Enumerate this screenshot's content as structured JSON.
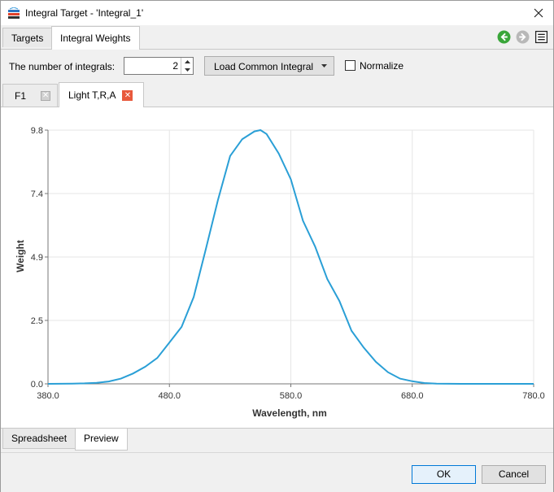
{
  "window": {
    "title": "Integral Target - 'Integral_1'"
  },
  "top_tabs": [
    {
      "label": "Targets",
      "active": false
    },
    {
      "label": "Integral Weights",
      "active": true
    }
  ],
  "toolbar": {
    "num_integrals_label": "The number of integrals:",
    "num_integrals_value": "2",
    "load_common_label": "Load Common Integral",
    "normalize_label": "Normalize",
    "normalize_checked": false
  },
  "integral_tabs": [
    {
      "label": "F1",
      "active": false
    },
    {
      "label": "Light T,R,A",
      "active": true
    }
  ],
  "bottom_tabs": [
    {
      "label": "Spreadsheet",
      "active": false
    },
    {
      "label": "Preview",
      "active": true
    }
  ],
  "footer": {
    "ok_label": "OK",
    "cancel_label": "Cancel"
  },
  "icons": {
    "app": "app-icon",
    "close": "close-icon",
    "back": "back-arrow-icon",
    "forward": "forward-arrow-icon",
    "notes": "notes-icon"
  },
  "colors": {
    "line": "#2a9fd6",
    "grid": "#e6e6e6",
    "close_tab_active": "#e8593c"
  },
  "chart_data": {
    "type": "line",
    "xlabel": "Wavelength, nm",
    "ylabel": "Weight",
    "xlim": [
      380,
      780
    ],
    "ylim": [
      0,
      9.8
    ],
    "x_ticks": [
      380.0,
      480.0,
      580.0,
      680.0,
      780.0
    ],
    "x_tick_labels": [
      "380.0",
      "480.0",
      "580.0",
      "680.0",
      "780.0"
    ],
    "y_ticks": [
      0,
      2.45,
      4.9,
      7.35,
      9.8
    ],
    "y_tick_labels": [
      "0.0",
      "2.5",
      "4.9",
      "7.4",
      "9.8"
    ],
    "grid": true,
    "series": [
      {
        "x": [
          380,
          400,
          410,
          420,
          430,
          440,
          450,
          460,
          470,
          480,
          490,
          500,
          510,
          520,
          530,
          540,
          550,
          555,
          560,
          570,
          580,
          590,
          600,
          610,
          620,
          630,
          640,
          650,
          660,
          670,
          680,
          690,
          700,
          720,
          740,
          760,
          780
        ],
        "y": [
          0,
          0.01,
          0.02,
          0.04,
          0.09,
          0.2,
          0.4,
          0.66,
          1.0,
          1.6,
          2.2,
          3.35,
          5.2,
          7.1,
          8.8,
          9.45,
          9.75,
          9.8,
          9.65,
          8.9,
          7.9,
          6.3,
          5.3,
          4.05,
          3.2,
          2.05,
          1.4,
          0.85,
          0.45,
          0.2,
          0.1,
          0.03,
          0.01,
          0.0,
          0.0,
          0.0,
          0.0
        ]
      }
    ]
  }
}
